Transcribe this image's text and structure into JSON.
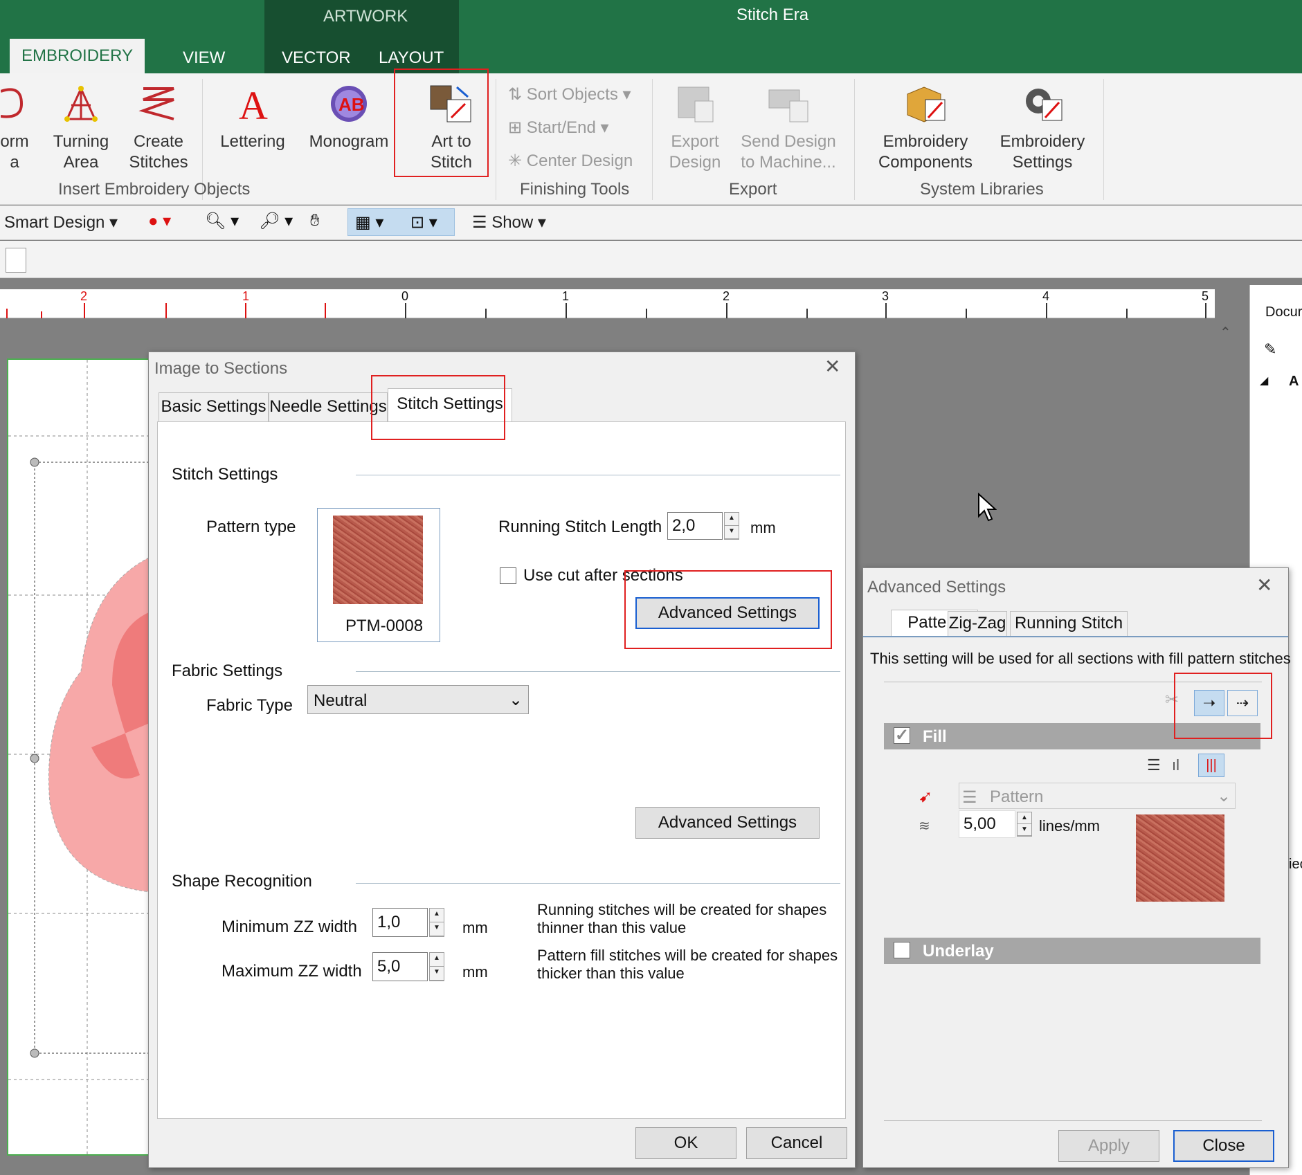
{
  "app": {
    "title": "Stitch Era"
  },
  "ribbon_tabs": {
    "context_header": "ARTWORK",
    "embroidery": "EMBROIDERY",
    "view": "VIEW",
    "vector": "VECTOR",
    "layout": "LAYOUT"
  },
  "ribbon": {
    "form_area": {
      "l1": "orm",
      "l2": "a"
    },
    "turning_area": {
      "l1": "Turning",
      "l2": "Area"
    },
    "create_stitches": {
      "l1": "Create",
      "l2": "Stitches"
    },
    "lettering": "Lettering",
    "monogram": "Monogram",
    "art_to_stitch": {
      "l1": "Art to",
      "l2": "Stitch"
    },
    "sort_objects": "Sort Objects",
    "start_end": "Start/End",
    "center_design": "Center Design",
    "export_design": {
      "l1": "Export",
      "l2": "Design"
    },
    "send_design": {
      "l1": "Send Design",
      "l2": "to Machine..."
    },
    "emb_components": {
      "l1": "Embroidery",
      "l2": "Components"
    },
    "emb_settings": {
      "l1": "Embroidery",
      "l2": "Settings"
    },
    "groups": {
      "insert": "Insert Embroidery Objects",
      "finishing": "Finishing Tools",
      "export": "Export",
      "libraries": "System Libraries"
    }
  },
  "toolbar": {
    "smart_design": "Smart Design",
    "show": "Show"
  },
  "ruler": {
    "labels": [
      "2",
      "1",
      "0",
      "1",
      "2",
      "3",
      "4",
      "5"
    ]
  },
  "right_pane": {
    "header": "Docur",
    "item": "A",
    "side": "iec"
  },
  "image_to_sections": {
    "title": "Image to Sections",
    "tabs": [
      "Basic Settings",
      "Needle Settings",
      "Stitch Settings"
    ],
    "stitch_settings_heading": "Stitch Settings",
    "pattern_type_label": "Pattern type",
    "pattern_code": "PTM-0008",
    "running_stitch_length_label": "Running Stitch Length",
    "running_stitch_length_value": "2,0",
    "unit_mm": "mm",
    "use_cut_label": "Use cut after sections",
    "advanced_settings_1": "Advanced Settings",
    "fabric_settings_heading": "Fabric Settings",
    "fabric_type_label": "Fabric Type",
    "fabric_type_value": "Neutral",
    "advanced_settings_2": "Advanced Settings",
    "shape_recognition_heading": "Shape Recognition",
    "min_zz_label": "Minimum ZZ width",
    "min_zz_value": "1,0",
    "max_zz_label": "Maximum ZZ width",
    "max_zz_value": "5,0",
    "min_desc_1": "Running stitches will be created for shapes",
    "min_desc_2": "thinner than this value",
    "max_desc_1": "Pattern fill stitches will be created for shapes",
    "max_desc_2": "thicker than this value",
    "ok": "OK",
    "cancel": "Cancel"
  },
  "advanced_settings": {
    "title": "Advanced Settings",
    "tabs": [
      "Pattern",
      "Zig-Zag",
      "Running Stitch"
    ],
    "info": "This setting will be used for all sections with fill pattern stitches",
    "fill_label": "Fill",
    "pattern_select": "Pattern",
    "density_value": "5,00",
    "density_unit": "lines/mm",
    "underlay_label": "Underlay",
    "apply": "Apply",
    "close": "Close"
  },
  "colors": {
    "accent": "#217346",
    "highlight_red": "#e02020",
    "pattern": "#b85a4c"
  }
}
